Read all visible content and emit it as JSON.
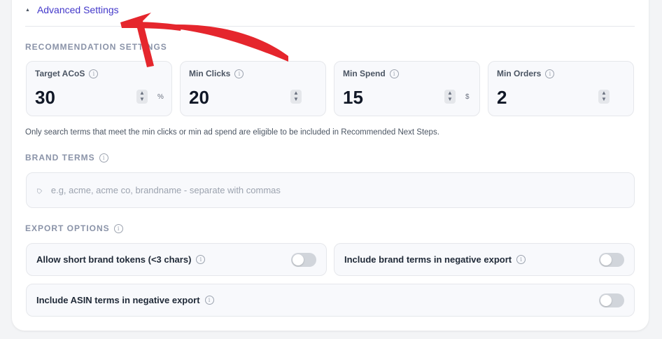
{
  "advanced": {
    "title": "Advanced Settings"
  },
  "recommendation": {
    "section_label": "RECOMMENDATION SETTINGS",
    "metrics": [
      {
        "label": "Target ACoS",
        "value": "30",
        "unit": "%"
      },
      {
        "label": "Min Clicks",
        "value": "20",
        "unit": ""
      },
      {
        "label": "Min Spend",
        "value": "15",
        "unit": "$"
      },
      {
        "label": "Min Orders",
        "value": "2",
        "unit": ""
      }
    ],
    "note": "Only search terms that meet the min clicks or min ad spend are eligible to be included in Recommended Next Steps."
  },
  "brand_terms": {
    "section_label": "BRAND TERMS",
    "placeholder": "e.g, acme, acme co, brandname - separate with commas"
  },
  "export_options": {
    "section_label": "EXPORT OPTIONS",
    "toggles": [
      {
        "label": "Allow short brand tokens (<3 chars)",
        "on": false
      },
      {
        "label": "Include brand terms in negative export",
        "on": false
      },
      {
        "label": "Include ASIN terms in negative export",
        "on": false
      }
    ]
  },
  "icons": {
    "info": "info-icon",
    "tag": "tag-icon",
    "stepper": "stepper-icon",
    "caret": "caret-up-icon"
  },
  "colors": {
    "accent": "#4338ca",
    "annotation": "#e5262d",
    "section_label": "#8a93a8"
  }
}
